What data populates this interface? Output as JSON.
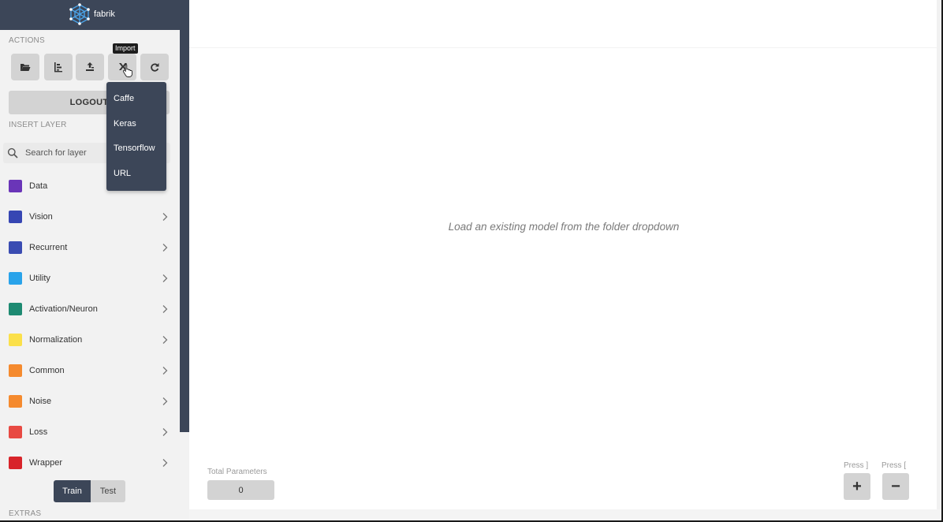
{
  "app": {
    "name": "fabrik"
  },
  "sidebar": {
    "actions_label": "ACTIONS",
    "actions": [
      {
        "icon": "folder-open-icon"
      },
      {
        "icon": "bar-chart-icon"
      },
      {
        "icon": "export-icon"
      },
      {
        "icon": "import-icon"
      },
      {
        "icon": "refresh-icon"
      }
    ],
    "logout_label": "LOGOUT",
    "insert_layer_label": "INSERT LAYER",
    "search_placeholder": "Search for layer",
    "categories": [
      {
        "label": "Data",
        "color": "#6a35b8"
      },
      {
        "label": "Vision",
        "color": "#3646b3"
      },
      {
        "label": "Recurrent",
        "color": "#3a4cb2"
      },
      {
        "label": "Utility",
        "color": "#29a3ea"
      },
      {
        "label": "Activation/Neuron",
        "color": "#1e8a72"
      },
      {
        "label": "Normalization",
        "color": "#fbe04a"
      },
      {
        "label": "Common",
        "color": "#f58a2e"
      },
      {
        "label": "Noise",
        "color": "#f58a2e"
      },
      {
        "label": "Loss",
        "color": "#e84a43"
      },
      {
        "label": "Wrapper",
        "color": "#d8242a"
      }
    ],
    "train_label": "Train",
    "test_label": "Test",
    "extras_label": "EXTRAS"
  },
  "tooltip": {
    "text": "Import"
  },
  "import_menu": {
    "items": [
      "Caffe",
      "Keras",
      "Tensorflow",
      "URL"
    ]
  },
  "canvas": {
    "hint": "Load an existing model from the folder dropdown",
    "total_parameters_label": "Total Parameters",
    "total_parameters_value": "0",
    "zoom_in_hint": "Press ]",
    "zoom_out_hint": "Press [",
    "zoom_in_symbol": "+",
    "zoom_out_symbol": "−"
  },
  "colors": {
    "sidebar_dark": "#3c4658",
    "button_gray": "#d3d3d3"
  }
}
